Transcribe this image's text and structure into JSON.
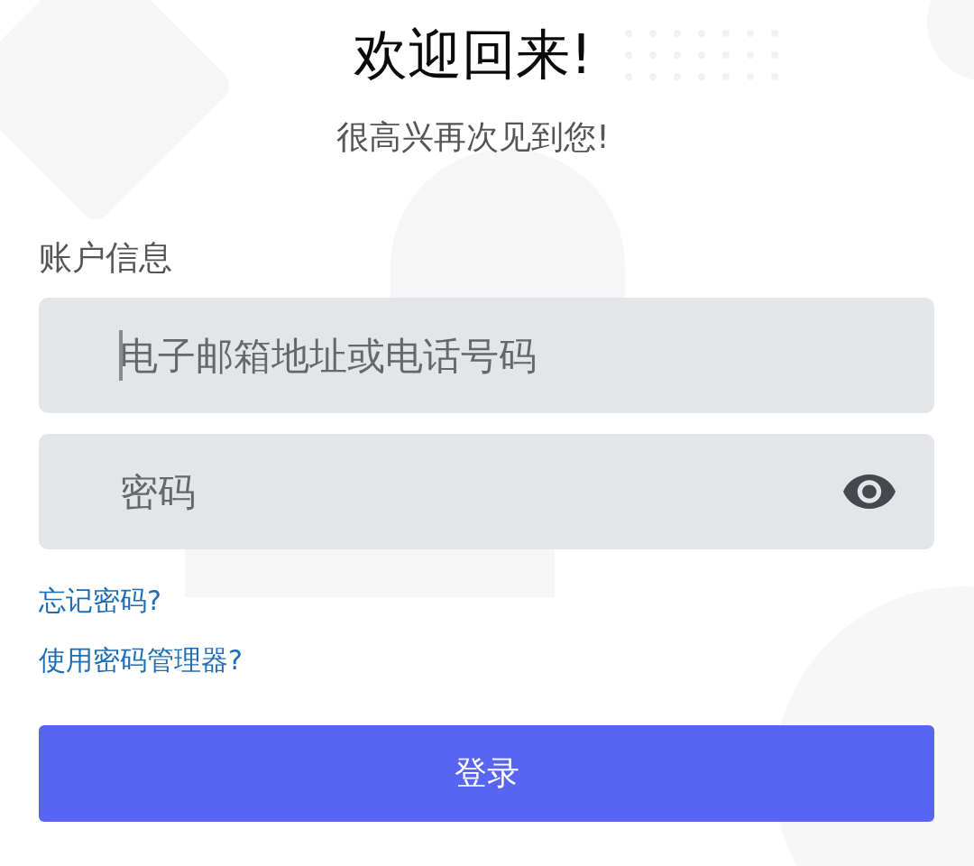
{
  "title": "欢迎回来!",
  "subtitle": "很高兴再次见到您!",
  "account_section": {
    "label": "账户信息",
    "fields": [
      {
        "kind": "text",
        "placeholder": "电子邮箱地址或电话号码",
        "focused": true
      },
      {
        "kind": "password",
        "placeholder": "密码",
        "focused": false
      }
    ]
  },
  "links": [
    "忘记密码?",
    "使用密码管理器?"
  ],
  "login_button": {
    "label": "登录"
  }
}
